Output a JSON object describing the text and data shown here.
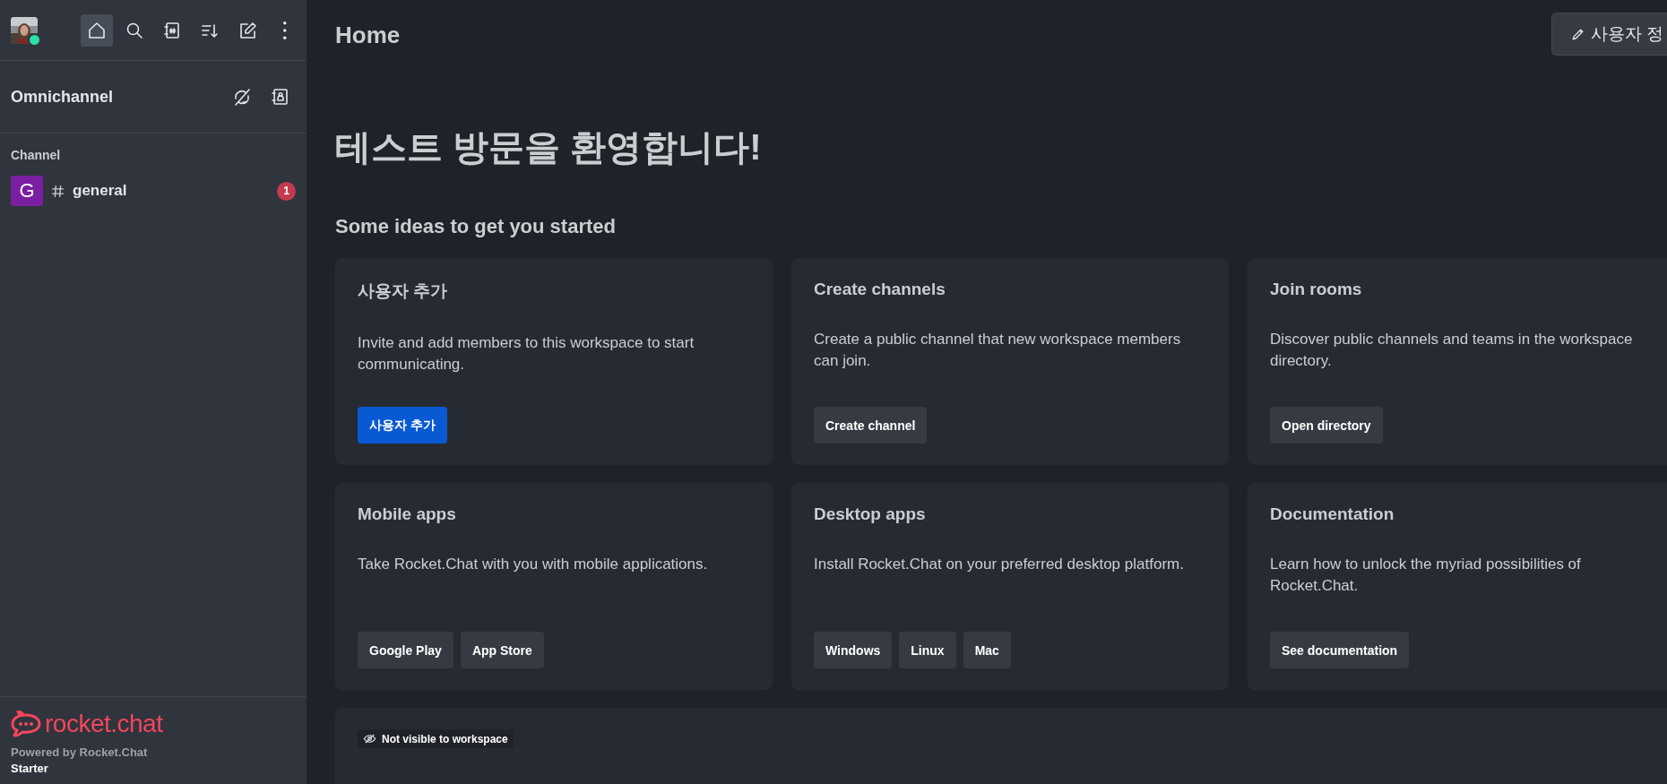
{
  "sidebar": {
    "user": {
      "online": true
    },
    "toolbar": [
      {
        "kind": "home",
        "selected": true
      },
      {
        "kind": "search",
        "selected": false
      },
      {
        "kind": "directory",
        "selected": false
      },
      {
        "kind": "sort",
        "selected": false
      },
      {
        "kind": "write",
        "selected": false
      },
      {
        "kind": "menu",
        "selected": false
      }
    ],
    "omnichannel": {
      "title": "Omnichannel",
      "actions": [
        {
          "kind": "offline"
        },
        {
          "kind": "contacts"
        }
      ]
    },
    "sections": [
      {
        "title": "Channel",
        "rooms": [
          {
            "avatar": "G",
            "color": "#7b1fa2",
            "name": "general",
            "unread": "1"
          }
        ]
      }
    ],
    "footer": {
      "logo": "rocket.chat",
      "powered": "Powered by Rocket.Chat",
      "plan": "Starter"
    }
  },
  "main": {
    "title": "Home",
    "header_button": "사용자 정",
    "welcome": "테스트 방문을 환영합니다!",
    "ideas_title": "Some ideas to get you started",
    "cards": [
      {
        "title": "사용자 추가",
        "text": "Invite and add members to this workspace to start communicating.",
        "buttons": [
          {
            "label": "사용자 추가",
            "kind": "primary"
          }
        ]
      },
      {
        "title": "Create channels",
        "text": "Create a public channel that new workspace members can join.",
        "buttons": [
          {
            "label": "Create channel",
            "kind": "secondary"
          }
        ]
      },
      {
        "title": "Join rooms",
        "text": "Discover public channels and teams in the workspace directory.",
        "buttons": [
          {
            "label": "Open directory",
            "kind": "secondary"
          }
        ]
      },
      {
        "title": "Mobile apps",
        "text": "Take Rocket.Chat with you with mobile applications.",
        "buttons": [
          {
            "label": "Google Play",
            "kind": "secondary"
          },
          {
            "label": "App Store",
            "kind": "secondary"
          }
        ]
      },
      {
        "title": "Desktop apps",
        "text": "Install Rocket.Chat on your preferred desktop platform.",
        "buttons": [
          {
            "label": "Windows",
            "kind": "secondary"
          },
          {
            "label": "Linux",
            "kind": "secondary"
          },
          {
            "label": "Mac",
            "kind": "secondary"
          }
        ]
      },
      {
        "title": "Documentation",
        "text": "Learn how to unlock the myriad possibilities of Rocket.Chat.",
        "buttons": [
          {
            "label": "See documentation",
            "kind": "secondary"
          }
        ]
      }
    ],
    "custom_block": {
      "tag": "Not visible to workspace"
    }
  }
}
